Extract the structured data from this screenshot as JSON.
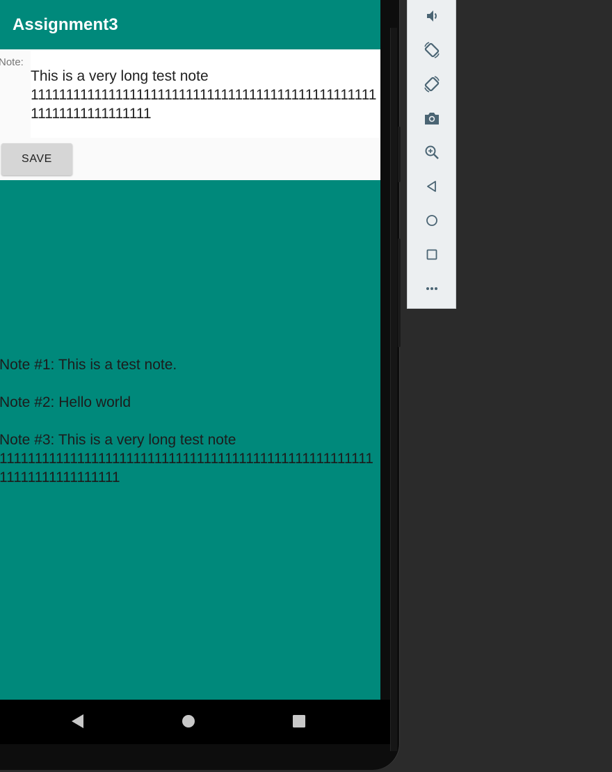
{
  "app": {
    "title": "Assignment3"
  },
  "editor": {
    "label": "Note:",
    "value": "This is a very long test note\n111111111111111111111111111111111111111111111111111111111111111111",
    "save_label": "SAVE"
  },
  "notes": [
    {
      "text": "Note #1: This is a test note."
    },
    {
      "text": "Note #2: Hello world"
    },
    {
      "text": "Note #3: This is a very long test note\n1111111111111111111111111111111111111111111111111111111111111111111111"
    }
  ],
  "navigation": {
    "icons": [
      "back-icon",
      "home-icon",
      "recents-icon"
    ]
  },
  "emulator_toolbar": {
    "icons": [
      "volume-down-icon",
      "rotate-left-icon",
      "rotate-right-icon",
      "camera-icon",
      "zoom-icon",
      "back-icon",
      "home-icon",
      "overview-icon",
      "more-icon"
    ]
  },
  "colors": {
    "primary": "#00897b",
    "background": "#2b2b2b",
    "toolbar": "#eceff1",
    "toolbar_icon": "#4a6473"
  }
}
